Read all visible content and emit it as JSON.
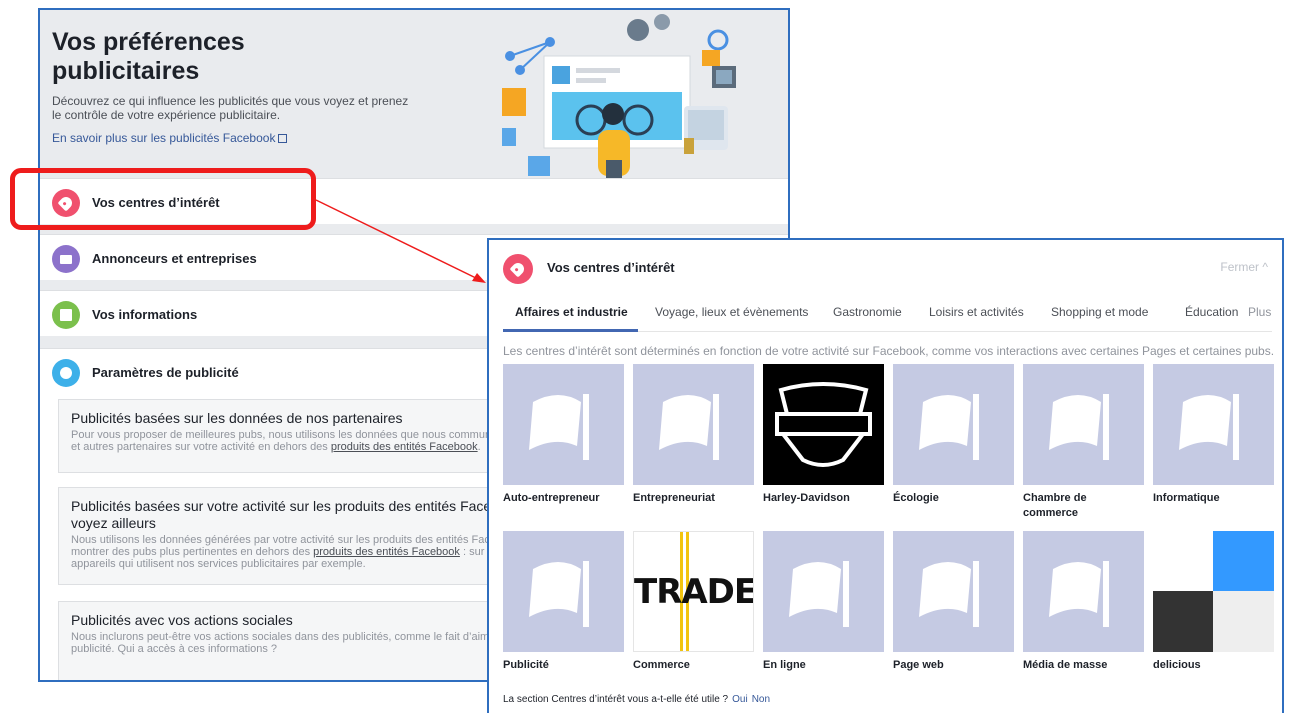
{
  "back": {
    "title_line1": "Vos préférences",
    "title_line2": "publicitaires",
    "description": "Découvrez ce qui influence les publicités que vous voyez et prenez le contrôle de votre expérience publicitaire.",
    "learn_more": "En savoir plus sur les publicités Facebook",
    "sections": [
      {
        "label": "Vos centres d’intérêt",
        "icon": "tag-icon"
      },
      {
        "label": "Annonceurs et entreprises",
        "icon": "briefcase-icon"
      },
      {
        "label": "Vos informations",
        "icon": "id-card-icon"
      },
      {
        "label": "Paramètres de publicité",
        "icon": "gear-icon"
      }
    ],
    "cards": [
      {
        "title": "Publicités basées sur les données de nos partenaires",
        "text_a": "Pour vous proposer de meilleures pubs, nous utilisons les données que nous communi",
        "text_b": "et autres partenaires sur votre activité en dehors des ",
        "link": "produits des entités Facebook",
        "text_c": "."
      },
      {
        "title": "Publicités basées sur votre activité sur les produits des entités Faceb",
        "title2": "voyez ailleurs",
        "text_a": "Nous utilisons les données générées par votre activité sur les produits des entités Fac",
        "text_b": "montrer des pubs plus pertinentes en dehors des ",
        "link": "produits des entités Facebook",
        "text_c": " : sur",
        "text_d": "appareils qui utilisent nos services publicitaires par exemple."
      },
      {
        "title": "Publicités avec vos actions sociales",
        "text_a": "Nous inclurons peut-être vos actions sociales dans des publicités, comme le fait d’aime",
        "text_b": "publicité. Qui a accès à ces informations ?"
      }
    ]
  },
  "front": {
    "title": "Vos centres d’intérêt",
    "close": "Fermer ^",
    "tabs": [
      "Affaires et industrie",
      "Voyage, lieux et évènements",
      "Gastronomie",
      "Loisirs et activités",
      "Shopping et mode",
      "Éducation",
      "Plus"
    ],
    "description": "Les centres d’intérêt sont déterminés en fonction de votre activité sur Facebook, comme vos interactions avec certaines Pages et certaines pubs.",
    "interests": [
      "Auto-entrepreneur",
      "Entrepreneuriat",
      "Harley-Davidson",
      "Écologie",
      "Chambre de commerce",
      "Informatique",
      "Publicité",
      "Commerce",
      "En ligne",
      "Page web",
      "Média de masse",
      "delicious"
    ],
    "trade_logo_text": "TRADE",
    "feedback_q": "La section Centres d’intérêt vous a-t-elle été utile ?",
    "feedback_yes": "Oui",
    "feedback_no": "Non"
  },
  "colors": {
    "highlight": "#ee1c1c",
    "frame_blue": "#2f6ebf",
    "tag_pink": "#f0506e",
    "brief_purple": "#8c72cb",
    "info_green": "#7bc04c",
    "gear_blue": "#3db0e9",
    "tile_placeholder": "#c5cae3",
    "link_blue": "#365899"
  }
}
